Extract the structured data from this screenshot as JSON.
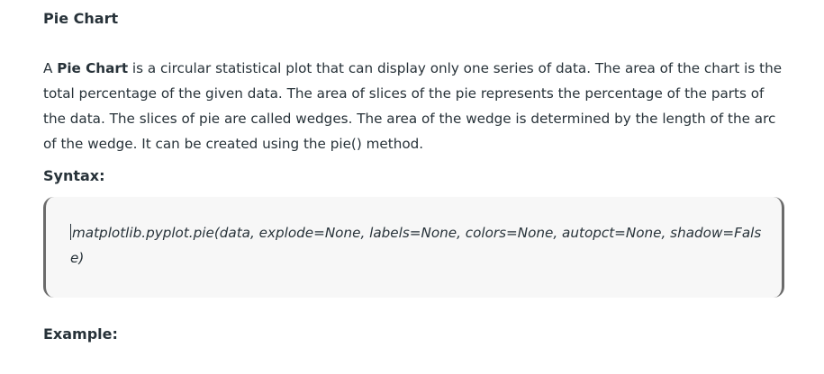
{
  "section_title": "Pie Chart",
  "intro": {
    "prefix": "A ",
    "term": "Pie Chart",
    "body": " is a circular statistical plot that can display only one series of data. The area of the chart is the total percentage of the given data. The area of slices of the pie represents the percentage of the parts of the data. The slices of pie are called wedges. The area of the wedge is determined by the length of the arc of the wedge. It can be created using the pie() method."
  },
  "syntax_heading": "Syntax:",
  "syntax_code": "matplotlib.pyplot.pie(data, explode=None, labels=None, colors=None, autopct=None, shadow=False)",
  "example_heading": "Example:"
}
